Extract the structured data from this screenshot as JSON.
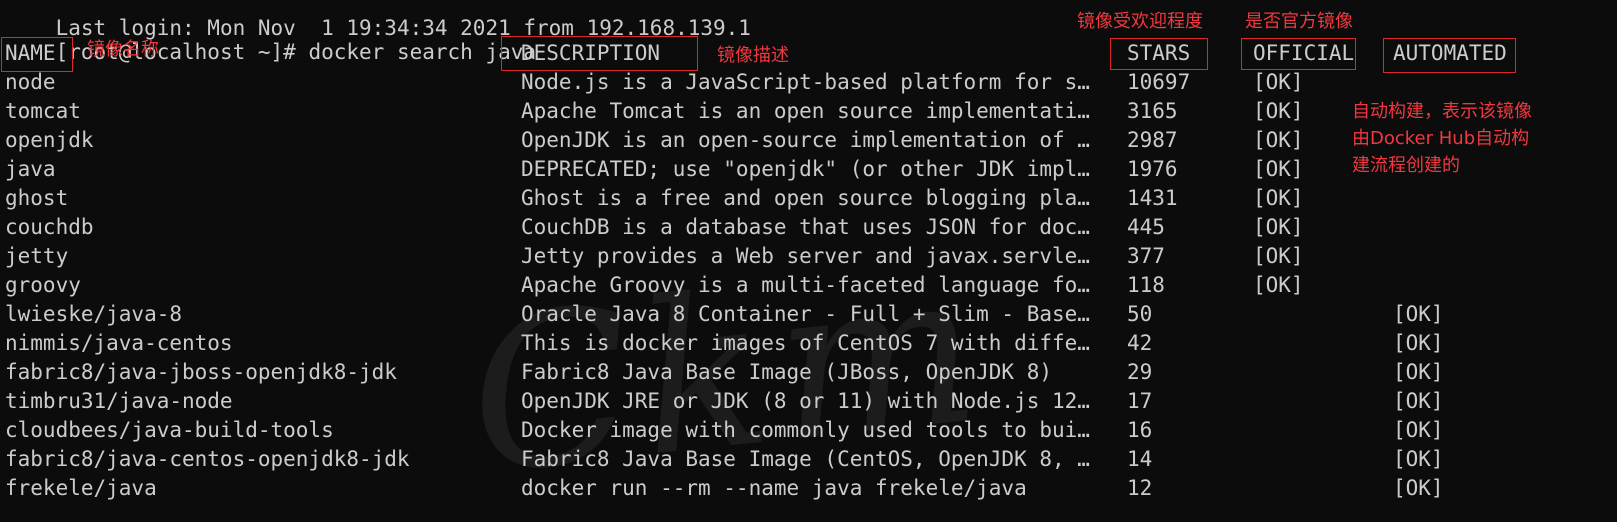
{
  "terminal": {
    "partial_top_line": "Last login: Mon Nov  1 19:34:34 2021 from 192.168.139.1",
    "prompt": "[root@localhost ~]# ",
    "command": "docker search java",
    "headers": {
      "name": "NAME",
      "description": "DESCRIPTION",
      "stars": "STARS",
      "official": "OFFICIAL",
      "automated": "AUTOMATED"
    },
    "rows": [
      {
        "name": "node",
        "description": "Node.js is a JavaScript-based platform for s…",
        "stars": "10697",
        "official": "[OK]",
        "automated": ""
      },
      {
        "name": "tomcat",
        "description": "Apache Tomcat is an open source implementati…",
        "stars": "3165",
        "official": "[OK]",
        "automated": ""
      },
      {
        "name": "openjdk",
        "description": "OpenJDK is an open-source implementation of …",
        "stars": "2987",
        "official": "[OK]",
        "automated": ""
      },
      {
        "name": "java",
        "description": "DEPRECATED; use \"openjdk\" (or other JDK impl…",
        "stars": "1976",
        "official": "[OK]",
        "automated": ""
      },
      {
        "name": "ghost",
        "description": "Ghost is a free and open source blogging pla…",
        "stars": "1431",
        "official": "[OK]",
        "automated": ""
      },
      {
        "name": "couchdb",
        "description": "CouchDB is a database that uses JSON for doc…",
        "stars": "445",
        "official": "[OK]",
        "automated": ""
      },
      {
        "name": "jetty",
        "description": "Jetty provides a Web server and javax.servle…",
        "stars": "377",
        "official": "[OK]",
        "automated": ""
      },
      {
        "name": "groovy",
        "description": "Apache Groovy is a multi-faceted language fo…",
        "stars": "118",
        "official": "[OK]",
        "automated": ""
      },
      {
        "name": "lwieske/java-8",
        "description": "Oracle Java 8 Container - Full + Slim - Base…",
        "stars": "50",
        "official": "",
        "automated": "[OK]"
      },
      {
        "name": "nimmis/java-centos",
        "description": "This is docker images of CentOS 7 with diffe…",
        "stars": "42",
        "official": "",
        "automated": "[OK]"
      },
      {
        "name": "fabric8/java-jboss-openjdk8-jdk",
        "description": "Fabric8 Java Base Image (JBoss, OpenJDK 8)",
        "stars": "29",
        "official": "",
        "automated": "[OK]"
      },
      {
        "name": "timbru31/java-node",
        "description": "OpenJDK JRE or JDK (8 or 11) with Node.js 12…",
        "stars": "17",
        "official": "",
        "automated": "[OK]"
      },
      {
        "name": "cloudbees/java-build-tools",
        "description": "Docker image with commonly used tools to bui…",
        "stars": "16",
        "official": "",
        "automated": "[OK]"
      },
      {
        "name": "fabric8/java-centos-openjdk8-jdk",
        "description": "Fabric8 Java Base Image (CentOS, OpenJDK 8, …",
        "stars": "14",
        "official": "",
        "automated": "[OK]"
      },
      {
        "name": "frekele/java",
        "description": "docker run --rm --name java frekele/java",
        "stars": "12",
        "official": "",
        "automated": "[OK]"
      }
    ]
  },
  "annotations": {
    "name_note": "镜像名称",
    "description_note": "镜像描述",
    "stars_note": "镜像受欢迎程度",
    "official_note": "是否官方镜像",
    "automated_note": [
      "自动构建，表示该镜像",
      "由Docker Hub自动构",
      "建流程创建的"
    ]
  },
  "colors": {
    "background": "#0c0c0c",
    "text": "#cccccc",
    "annotation_red": "#f0383f"
  }
}
